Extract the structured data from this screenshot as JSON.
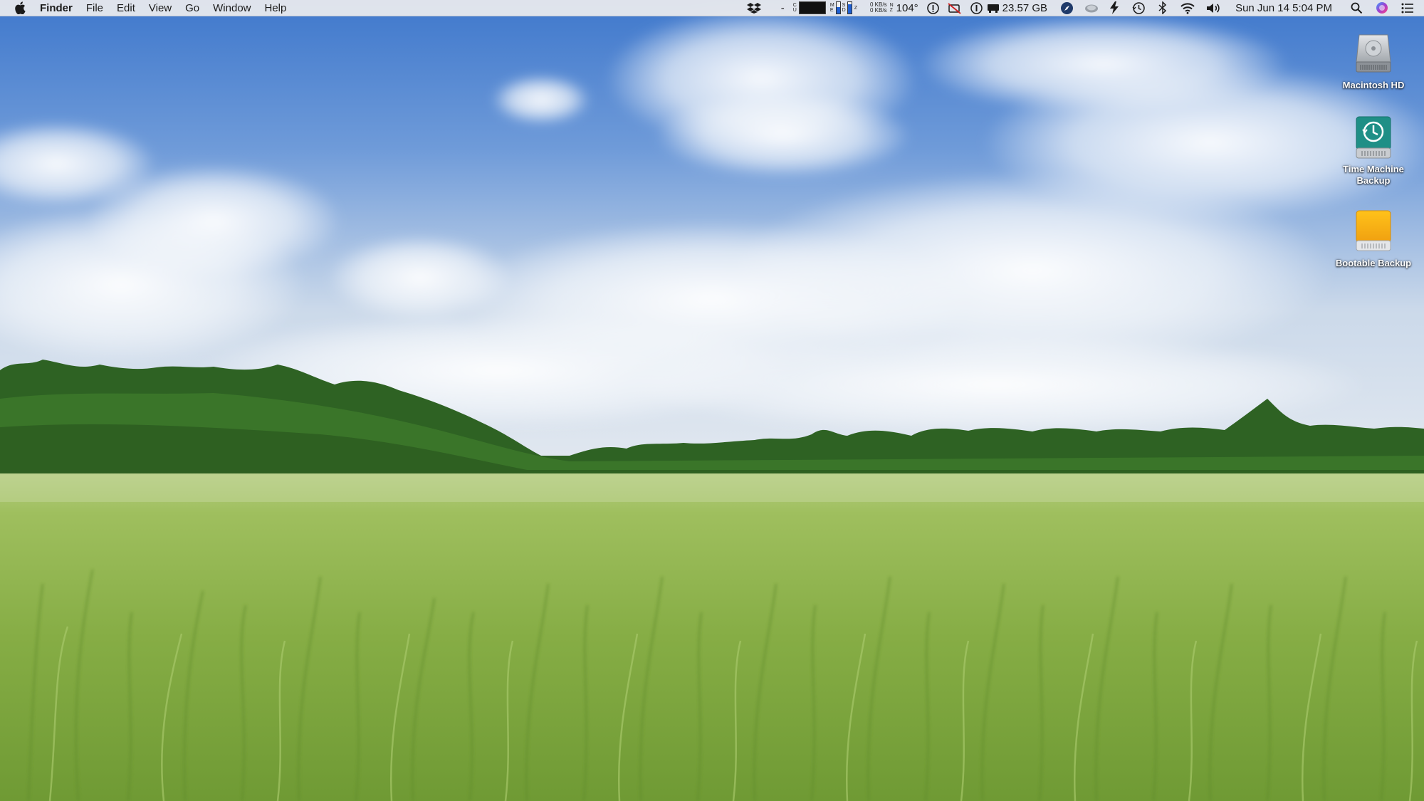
{
  "menubar": {
    "app_name": "Finder",
    "menus": [
      "File",
      "Edit",
      "View",
      "Go",
      "Window",
      "Help"
    ],
    "status": {
      "dash": "-",
      "net_up": "0 KB/s",
      "net_down": "0 KB/s",
      "temperature": "104°",
      "disk_free": "23.57 GB",
      "datetime": "Sun Jun 14  5:04 PM"
    },
    "icons": [
      "apple-icon",
      "dropbox-icon",
      "cpu-graph-icon",
      "memory-bars-icon",
      "info-icon",
      "notifications-off-icon",
      "battery-icon",
      "compass-icon",
      "cloud-icon",
      "bolt-icon",
      "time-machine-icon",
      "bluetooth-icon",
      "wifi-icon",
      "volume-icon",
      "spotlight-icon",
      "siri-icon",
      "notification-center-icon"
    ]
  },
  "desktop": {
    "icons": [
      {
        "label": "Macintosh HD",
        "icon": "hard-drive-icon"
      },
      {
        "label": "Time Machine Backup",
        "icon": "time-machine-drive-icon"
      },
      {
        "label": "Bootable Backup",
        "icon": "external-drive-icon"
      }
    ]
  },
  "colors": {
    "sky_top": "#4f86d4",
    "sky_bottom": "#dfe7f0",
    "treeline": "#2f6a22",
    "grass": "#8fb550",
    "time_machine_teal": "#1f8f86",
    "bootable_orange": "#f5b118"
  }
}
